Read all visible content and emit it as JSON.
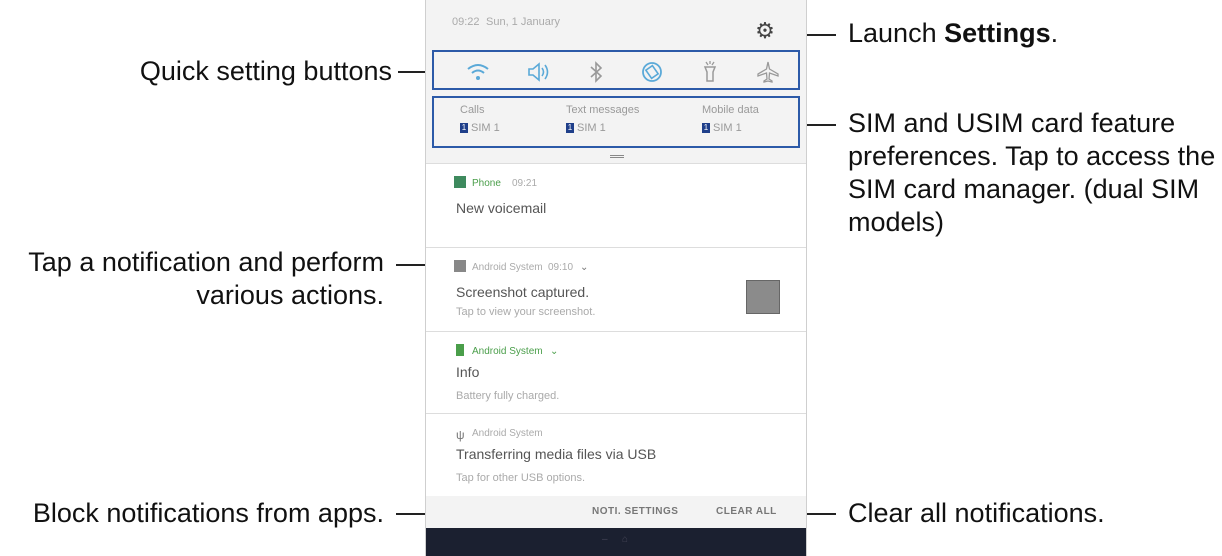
{
  "labels": {
    "quick_settings": "Quick setting buttons",
    "launch_prefix": "Launch ",
    "launch_bold": "Settings",
    "launch_suffix": ".",
    "sim_line1": "SIM and USIM card feature",
    "sim_line2": "preferences. Tap to access the",
    "sim_line3": "SIM card manager. (dual SIM",
    "sim_line4": "models)",
    "tap_line1": "Tap a notification and perform",
    "tap_line2": "various actions.",
    "block": "Block notifications from apps.",
    "clear": "Clear all notifications."
  },
  "status": {
    "time": "09:22",
    "date": "Sun, 1 January"
  },
  "quick_icons": [
    "wifi-icon",
    "sound-icon",
    "bluetooth-icon",
    "auto-rotate-icon",
    "flashlight-icon",
    "airplane-icon"
  ],
  "sim": {
    "calls_title": "Calls",
    "calls_value": "SIM 1",
    "text_title": "Text messages",
    "text_value": "SIM 1",
    "data_title": "Mobile data",
    "data_value": "SIM 1",
    "sim_tag": "1"
  },
  "notifications": [
    {
      "app": "Phone",
      "time": "09:21",
      "title": "New voicemail",
      "sub": ""
    },
    {
      "app": "Android System",
      "time": "09:10",
      "title": "Screenshot captured.",
      "sub": "Tap to view your screenshot."
    },
    {
      "app": "Android System",
      "time": "",
      "title": "Info",
      "sub": "Battery fully charged."
    },
    {
      "app": "Android System",
      "time": "",
      "title": "Transferring media files via USB",
      "sub": "Tap for other USB options."
    }
  ],
  "actions": {
    "noti_settings": "NOTI. SETTINGS",
    "clear_all": "CLEAR ALL"
  },
  "colors": {
    "callout_box": "#2c5aa8",
    "green_app": "#4a9e4a",
    "navbar": "#1b2030"
  }
}
